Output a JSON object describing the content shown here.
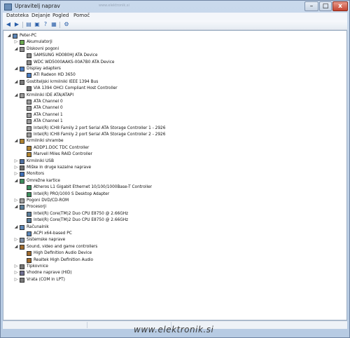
{
  "window": {
    "title": "Upravitelj naprav",
    "address_text": "www.elektronik.si"
  },
  "menu": [
    "Datoteka",
    "Dejanje",
    "Pogled",
    "Pomoč"
  ],
  "toolbar_icons": [
    "back-icon",
    "forward-icon",
    "properties-icon",
    "show-hidden-icon",
    "help-icon",
    "scan-icon"
  ],
  "tree": [
    {
      "depth": 0,
      "exp": "-",
      "icon": "computer",
      "label": "Peter-PC"
    },
    {
      "depth": 1,
      "exp": "+",
      "icon": "battery",
      "label": "Akumulatorji"
    },
    {
      "depth": 1,
      "exp": "-",
      "icon": "disk",
      "label": "Diskovni pogoni"
    },
    {
      "depth": 2,
      "exp": "",
      "icon": "disk",
      "label": "SAMSUNG HD080HJ ATA Device"
    },
    {
      "depth": 2,
      "exp": "",
      "icon": "disk",
      "label": "WDC WD5000AAKS-00A7B0 ATA Device"
    },
    {
      "depth": 1,
      "exp": "-",
      "icon": "display",
      "label": "Display adapters"
    },
    {
      "depth": 2,
      "exp": "",
      "icon": "display",
      "label": "ATI Radeon HD 3650"
    },
    {
      "depth": 1,
      "exp": "-",
      "icon": "port",
      "label": "Gostiteljski krmilniki IEEE 1394 Bus"
    },
    {
      "depth": 2,
      "exp": "",
      "icon": "port",
      "label": "VIA 1394 OHCI Compliant Host Controller"
    },
    {
      "depth": 1,
      "exp": "-",
      "icon": "ide",
      "label": "Krmilniki IDE ATA/ATAPI"
    },
    {
      "depth": 2,
      "exp": "",
      "icon": "ide",
      "label": "ATA Channel 0"
    },
    {
      "depth": 2,
      "exp": "",
      "icon": "ide",
      "label": "ATA Channel 0"
    },
    {
      "depth": 2,
      "exp": "",
      "icon": "ide",
      "label": "ATA Channel 1"
    },
    {
      "depth": 2,
      "exp": "",
      "icon": "ide",
      "label": "ATA Channel 1"
    },
    {
      "depth": 2,
      "exp": "",
      "icon": "ide",
      "label": "Intel(R) ICH8 Family 2 port Serial ATA Storage Controller 1 - 2926"
    },
    {
      "depth": 2,
      "exp": "",
      "icon": "ide",
      "label": "Intel(R) ICH8 Family 2 port Serial ATA Storage Controller 2 - 2926"
    },
    {
      "depth": 1,
      "exp": "-",
      "icon": "storage",
      "label": "Krmilniki shrambe"
    },
    {
      "depth": 2,
      "exp": "",
      "icon": "storage",
      "label": "ADDP1.DOC TDC Controller"
    },
    {
      "depth": 2,
      "exp": "",
      "icon": "storage",
      "label": "Marvell Miles RAID Controller"
    },
    {
      "depth": 1,
      "exp": "+",
      "icon": "usb",
      "label": "Krmilniki USB"
    },
    {
      "depth": 1,
      "exp": "+",
      "icon": "mouse",
      "label": "Miške in druge kazalne naprave"
    },
    {
      "depth": 1,
      "exp": "+",
      "icon": "monitor",
      "label": "Monitors"
    },
    {
      "depth": 1,
      "exp": "-",
      "icon": "network",
      "label": "Omrežne kartice"
    },
    {
      "depth": 2,
      "exp": "",
      "icon": "network",
      "label": "Atheros L1 Gigabit Ethernet 10/100/1000Base-T Controller"
    },
    {
      "depth": 2,
      "exp": "",
      "icon": "network",
      "label": "Intel(R) PRO/1000 S Desktop Adapter"
    },
    {
      "depth": 1,
      "exp": "+",
      "icon": "dvd",
      "label": "Pogoni DVD/CD-ROM"
    },
    {
      "depth": 1,
      "exp": "-",
      "icon": "cpu",
      "label": "Procesorji"
    },
    {
      "depth": 2,
      "exp": "",
      "icon": "cpu",
      "label": "Intel(R) Core(TM)2 Duo CPU     E8750  @ 2.66GHz"
    },
    {
      "depth": 2,
      "exp": "",
      "icon": "cpu",
      "label": "Intel(R) Core(TM)2 Duo CPU     E8750  @ 2.66GHz"
    },
    {
      "depth": 1,
      "exp": "-",
      "icon": "computer",
      "label": "Računalnik"
    },
    {
      "depth": 2,
      "exp": "",
      "icon": "computer",
      "label": "ACPI x64-based PC"
    },
    {
      "depth": 1,
      "exp": "+",
      "icon": "system",
      "label": "Sistemske naprave"
    },
    {
      "depth": 1,
      "exp": "-",
      "icon": "sound",
      "label": "Sound, video and game controllers"
    },
    {
      "depth": 2,
      "exp": "",
      "icon": "sound",
      "label": "High Definition Audio Device"
    },
    {
      "depth": 2,
      "exp": "",
      "icon": "sound",
      "label": "Realtek High Definition Audio"
    },
    {
      "depth": 1,
      "exp": "+",
      "icon": "keyboard",
      "label": "Tipkovnice"
    },
    {
      "depth": 1,
      "exp": "+",
      "icon": "hid",
      "label": "Vhodne naprave (HID)"
    },
    {
      "depth": 1,
      "exp": "+",
      "icon": "port",
      "label": "Vrata (COM in LPT)"
    }
  ],
  "watermark": "www.elektronik.si",
  "colors": {
    "accent": "#2a5ea8",
    "frame": "#b7cbe3"
  }
}
